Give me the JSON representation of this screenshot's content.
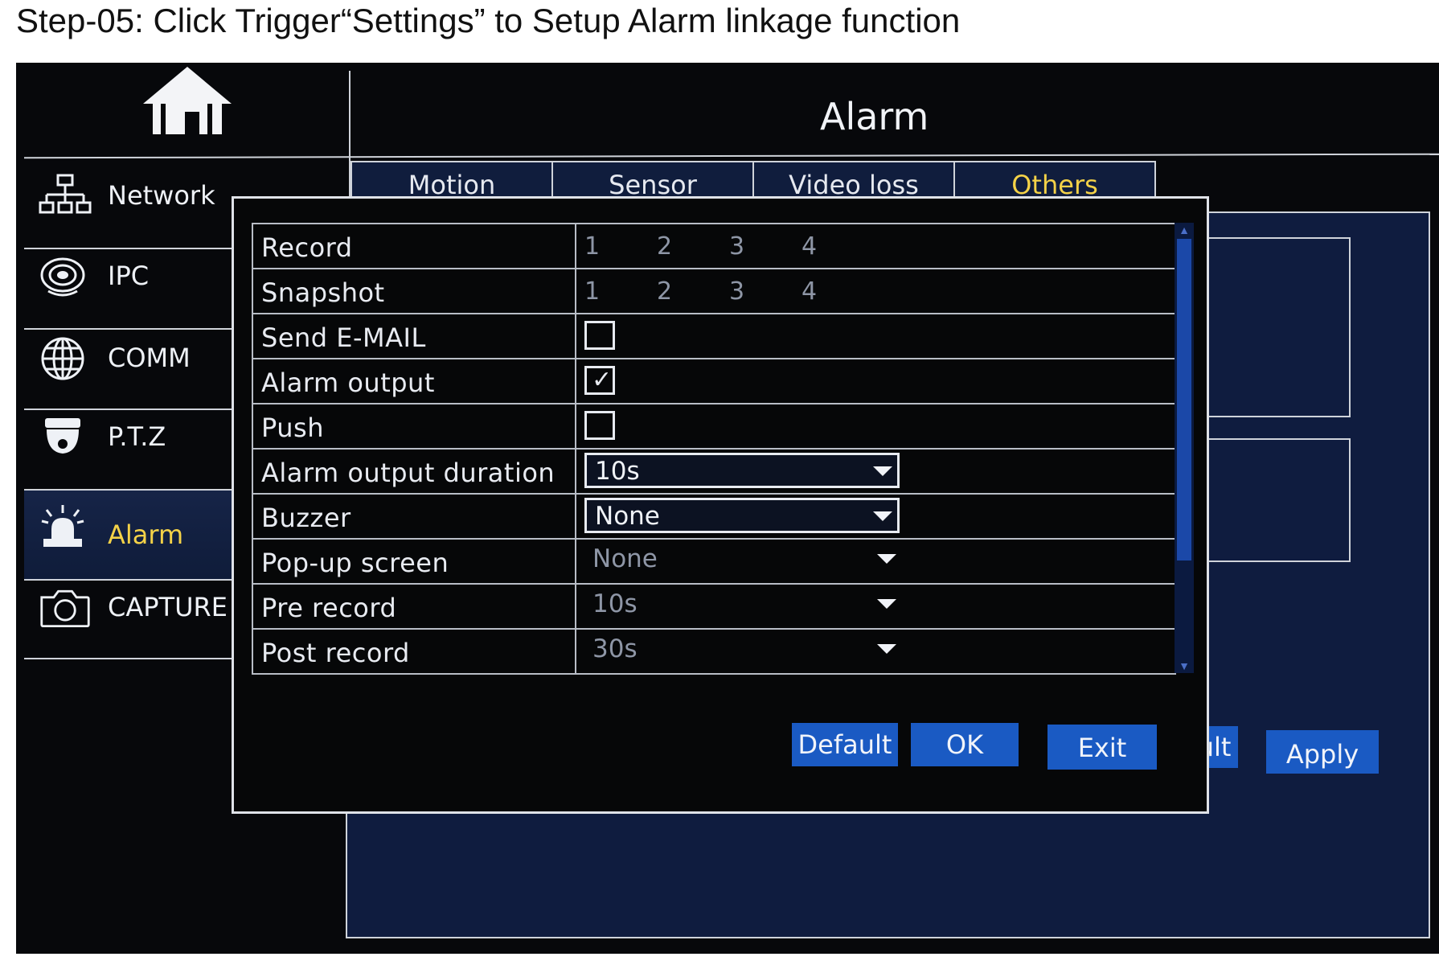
{
  "caption": "Step-05: Click Trigger“Settings” to Setup Alarm linkage function",
  "header": {
    "title": "Alarm"
  },
  "sidebar": {
    "items": [
      {
        "label": "Network",
        "icon": "network-icon"
      },
      {
        "label": "IPC",
        "icon": "camera-lens-icon"
      },
      {
        "label": "COMM",
        "icon": "globe-icon"
      },
      {
        "label": "P.T.Z",
        "icon": "dome-camera-icon"
      },
      {
        "label": "Alarm",
        "icon": "alarm-siren-icon",
        "active": true
      },
      {
        "label": "CAPTURE",
        "icon": "capture-camera-icon"
      }
    ]
  },
  "tabs": [
    {
      "label": "Motion"
    },
    {
      "label": "Sensor"
    },
    {
      "label": "Video loss"
    },
    {
      "label": "Others",
      "active": true
    }
  ],
  "dialog": {
    "rows": {
      "record": {
        "label": "Record",
        "channels": [
          "1",
          "2",
          "3",
          "4"
        ]
      },
      "snapshot": {
        "label": "Snapshot",
        "channels": [
          "1",
          "2",
          "3",
          "4"
        ]
      },
      "send_email": {
        "label": "Send E-MAIL",
        "checked": false
      },
      "alarm_output": {
        "label": "Alarm output",
        "checked": true
      },
      "push": {
        "label": "Push",
        "checked": false
      },
      "alarm_output_duration": {
        "label": "Alarm output duration",
        "value": "10s"
      },
      "buzzer": {
        "label": "Buzzer",
        "value": "None"
      },
      "popup_screen": {
        "label": "Pop-up screen",
        "value": "None"
      },
      "pre_record": {
        "label": "Pre record",
        "value": "10s"
      },
      "post_record": {
        "label": "Post record",
        "value": "30s"
      }
    },
    "buttons": {
      "default": "Default",
      "ok": "OK",
      "exit": "Exit"
    }
  },
  "page_buttons": {
    "default": "Default",
    "apply": "Apply"
  },
  "colors": {
    "accent_blue": "#1a5ac3",
    "active_yellow": "#f4d248",
    "panel_blue": "#0f1c3f"
  }
}
